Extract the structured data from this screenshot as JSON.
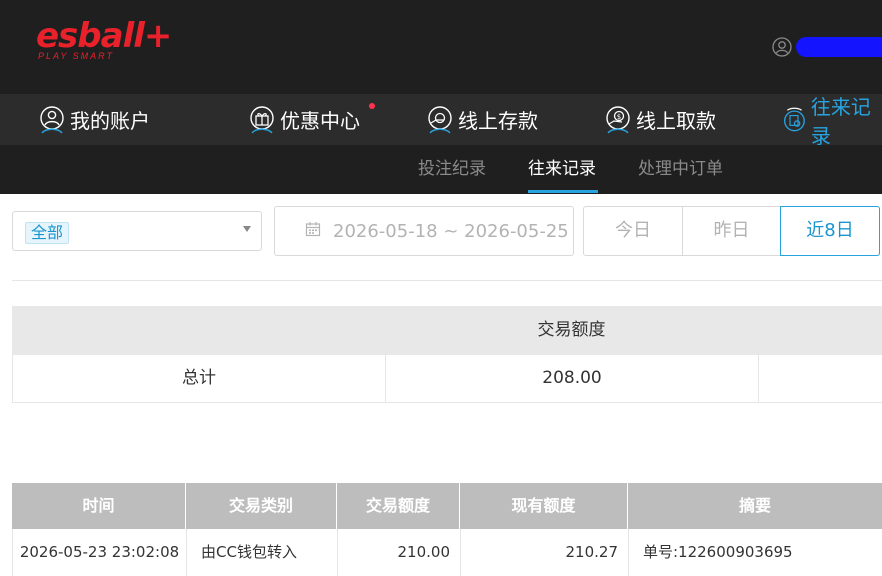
{
  "header": {
    "logo_text": "esball+",
    "logo_tagline": "PLAY SMART"
  },
  "main_nav": [
    {
      "label": "我的账户",
      "icon": "user-icon"
    },
    {
      "label": "优惠中心",
      "icon": "gift-icon"
    },
    {
      "label": "线上存款",
      "icon": "deposit-icon"
    },
    {
      "label": "线上取款",
      "icon": "withdraw-icon"
    },
    {
      "label": "往来记录",
      "icon": "records-icon"
    }
  ],
  "sub_nav": [
    {
      "label": "投注纪录"
    },
    {
      "label": "往来记录"
    },
    {
      "label": "处理中订单"
    }
  ],
  "filters": {
    "type_selected": "全部",
    "date_range": "2026-05-18 ~ 2026-05-25",
    "quick_ranges": [
      "今日",
      "昨日",
      "近8日"
    ]
  },
  "summary": {
    "header": "交易额度",
    "label": "总计",
    "total": "208.00"
  },
  "transactions": {
    "columns": [
      "时间",
      "交易类别",
      "交易额度",
      "现有额度",
      "摘要"
    ],
    "rows": [
      [
        "2026-05-23 23:02:08",
        "由CC钱包转入",
        "210.00",
        "210.27",
        "单号:122600903695"
      ]
    ]
  },
  "colors": {
    "brand_red": "#e8212b",
    "accent_blue": "#27a3e0",
    "header_bg": "#1f1f1f",
    "nav_bg": "#2c2c2c"
  }
}
